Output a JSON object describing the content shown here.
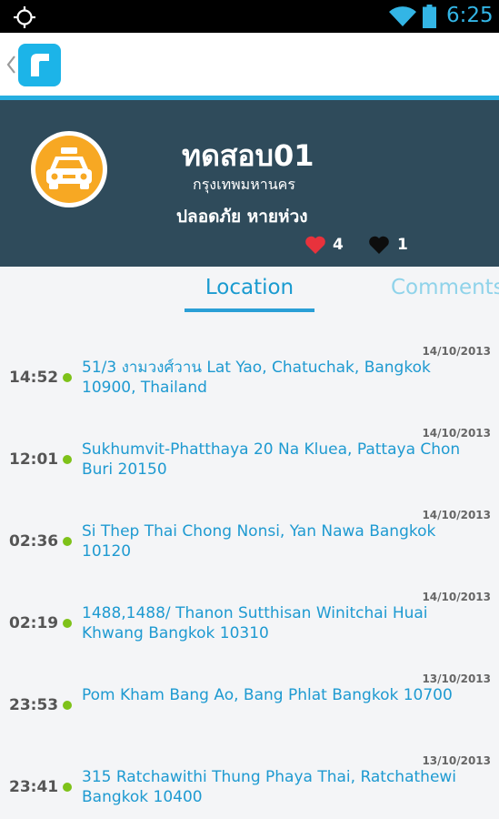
{
  "status_bar": {
    "time": "6:25"
  },
  "profile": {
    "name": "ทดสอบ01",
    "city": "กรุงเทพมหานคร",
    "status": "ปลอดภัย หายห่วง",
    "likes": "4",
    "dislikes": "1"
  },
  "tabs": {
    "location": "Location",
    "comments": "Comments"
  },
  "locations": [
    {
      "date": "14/10/2013",
      "time": "14:52",
      "address": "51/3 งามวงศ์วาน Lat Yao, Chatuchak, Bangkok 10900, Thailand"
    },
    {
      "date": "14/10/2013",
      "time": "12:01",
      "address": "Sukhumvit-Phatthaya 20 Na Kluea, Pattaya Chon Buri 20150"
    },
    {
      "date": "14/10/2013",
      "time": "02:36",
      "address": "Si Thep Thai Chong Nonsi, Yan Nawa Bangkok 10120"
    },
    {
      "date": "14/10/2013",
      "time": "02:19",
      "address": "1488,1488/ Thanon Sutthisan Winitchai Huai Khwang Bangkok 10310"
    },
    {
      "date": "13/10/2013",
      "time": "23:53",
      "address": "Pom Kham Bang Ao, Bang Phlat Bangkok 10700"
    },
    {
      "date": "13/10/2013",
      "time": "23:41",
      "address": "315 Ratchawithi Thung Phaya Thai, Ratchathewi Bangkok 10400"
    }
  ],
  "colors": {
    "accent": "#26aee0",
    "header_bg": "#2f4b5b",
    "dot": "#7ec219",
    "like": "#e8323c"
  },
  "icons": [
    "gps-icon",
    "wifi-icon",
    "battery-icon",
    "back-chevron-icon",
    "app-logo-icon",
    "taxi-icon",
    "heart-icon",
    "dark-heart-icon"
  ]
}
